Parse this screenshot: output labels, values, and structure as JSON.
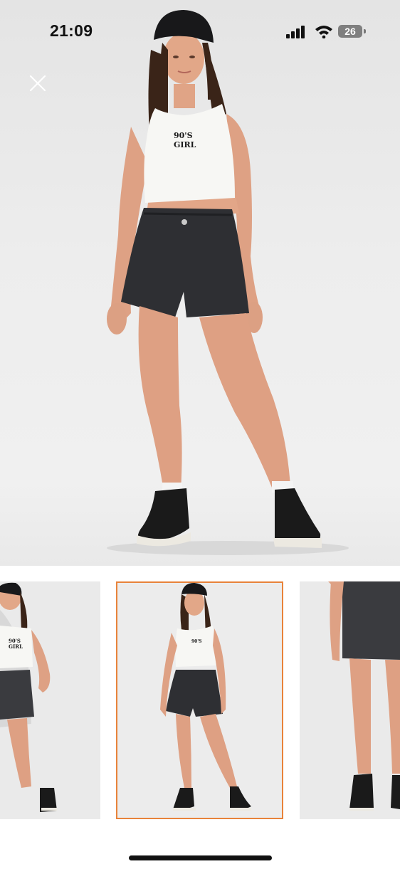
{
  "status_bar": {
    "time": "21:09",
    "battery_level": "26",
    "icons": [
      "signal-icon",
      "wifi-icon",
      "battery-icon"
    ]
  },
  "toolbar": {
    "close_icon": "close-icon"
  },
  "product": {
    "shirt_print": "90'S GIRL",
    "shirt_print_line1": "90'S",
    "shirt_print_line2": "GIRL"
  },
  "gallery": {
    "selected_index": 1,
    "accent_color": "#e8833a",
    "thumbnails": [
      "front-look-left",
      "front-look-center",
      "shorts-detail"
    ]
  }
}
